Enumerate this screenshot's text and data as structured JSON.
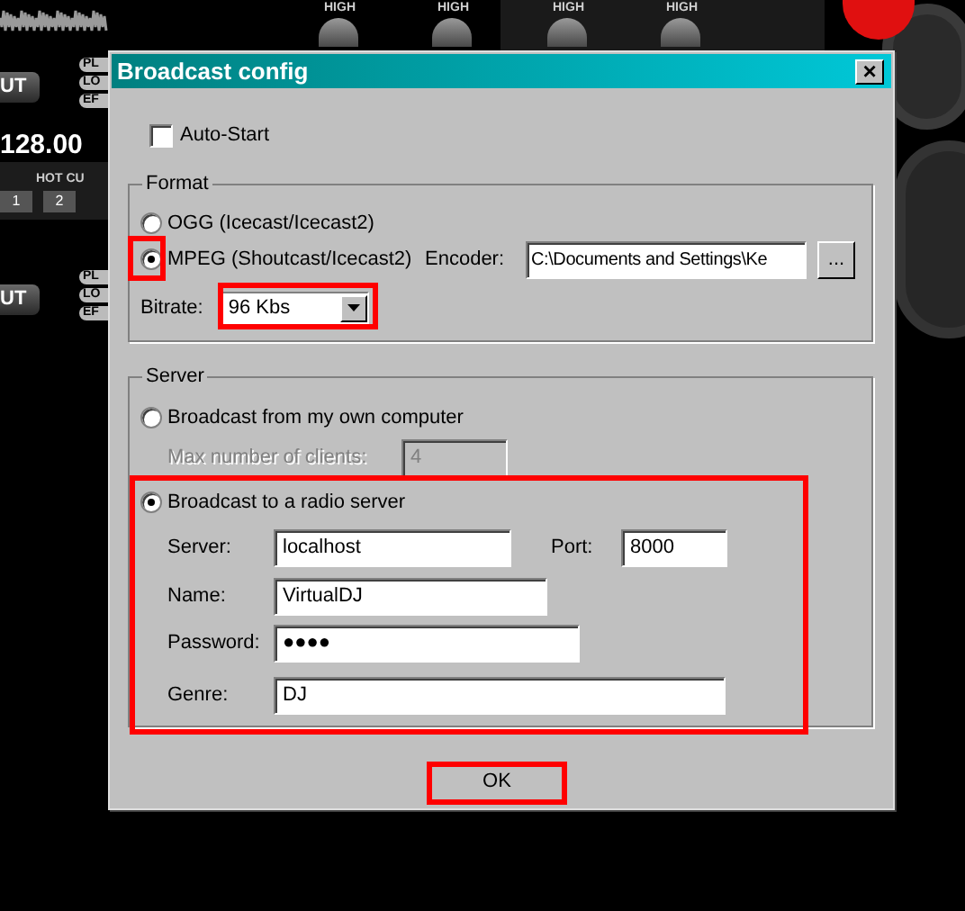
{
  "background_app": {
    "eq_labels": [
      "HIGH",
      "HIGH",
      "HIGH",
      "HIGH"
    ],
    "bpm": "128.00",
    "hot_cue_label": "HOT CU",
    "cue_buttons": [
      "1",
      "2"
    ],
    "deck_buttons": [
      "UT",
      "UT"
    ],
    "small_buttons": [
      [
        "PL",
        "LO",
        "EF"
      ],
      [
        "PL",
        "LO",
        "EF"
      ]
    ]
  },
  "dialog": {
    "title": "Broadcast config",
    "close": "×",
    "auto_start": {
      "label": "Auto-Start",
      "checked": false
    },
    "format": {
      "legend": "Format",
      "options": [
        {
          "label": "OGG (Icecast/Icecast2)",
          "selected": false
        },
        {
          "label": "MPEG (Shoutcast/Icecast2)",
          "selected": true
        }
      ],
      "encoder": {
        "label": "Encoder:",
        "value": "C:\\Documents and Settings\\Ke",
        "browse": "..."
      },
      "bitrate": {
        "label": "Bitrate:",
        "value": "96 Kbs"
      }
    },
    "server": {
      "legend": "Server",
      "modes": [
        {
          "label": "Broadcast from my own computer",
          "selected": false
        },
        {
          "label": "Broadcast to a radio server",
          "selected": true
        }
      ],
      "max_clients": {
        "label": "Max number of clients:",
        "value": "4",
        "disabled": true
      },
      "server": {
        "label": "Server:",
        "value": "localhost"
      },
      "port": {
        "label": "Port:",
        "value": "8000"
      },
      "name": {
        "label": "Name:",
        "value": "VirtualDJ"
      },
      "password": {
        "label": "Password:",
        "value": "●●●●"
      },
      "genre": {
        "label": "Genre:",
        "value": "DJ"
      }
    },
    "ok": "OK"
  }
}
